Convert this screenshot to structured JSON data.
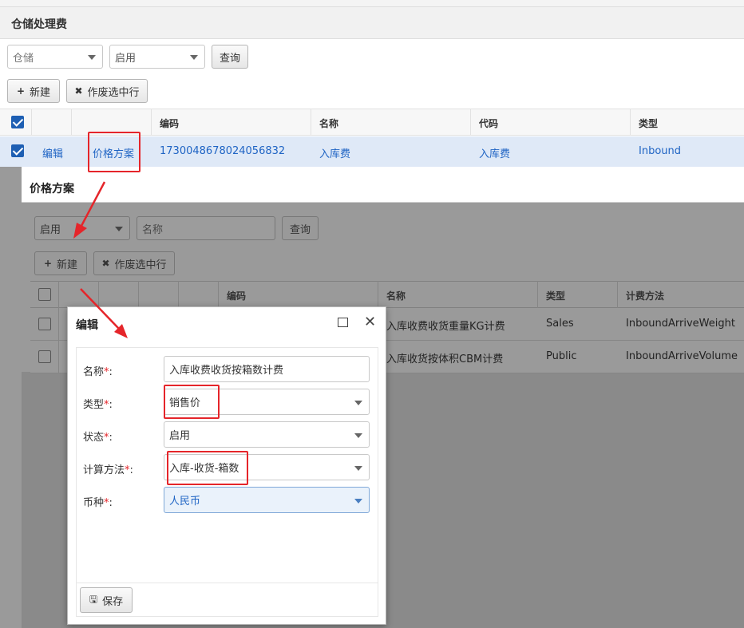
{
  "main": {
    "title": "仓储处理费",
    "filter_type": "仓储",
    "filter_status": "启用",
    "query_label": "查询",
    "new_label": "新建",
    "void_label": "作废选中行",
    "columns": [
      "编码",
      "名称",
      "代码",
      "类型"
    ],
    "row": {
      "edit": "编辑",
      "price_plan": "价格方案",
      "code": "1730048678024056832",
      "name": "入库费",
      "abbr": "入库费",
      "type": "Inbound"
    }
  },
  "price_window": {
    "title": "价格方案",
    "filter_status": "启用",
    "name_placeholder": "名称",
    "query_label": "查询",
    "new_label": "新建",
    "void_label": "作废选中行",
    "columns": [
      "编码",
      "名称",
      "类型",
      "计费方法"
    ],
    "rows": [
      {
        "name": "入库收费收货重量KG计费",
        "type": "Sales",
        "method": "InboundArriveWeight"
      },
      {
        "name": "入库收货按体积CBM计费",
        "type": "Public",
        "method": "InboundArriveVolume"
      }
    ]
  },
  "edit_dialog": {
    "title": "编辑",
    "fields": [
      {
        "label": "名称",
        "value": "入库收费收货按箱数计费"
      },
      {
        "label": "类型",
        "value": "销售价"
      },
      {
        "label": "状态",
        "value": "启用"
      },
      {
        "label": "计算方法",
        "value": "入库-收货-箱数"
      },
      {
        "label": "币种",
        "value": "人民币"
      }
    ],
    "required_mark": "*",
    "colon": ":",
    "save_label": "保存"
  },
  "colors": {
    "accent": "#1f64c4",
    "annotation": "#e5252a"
  }
}
